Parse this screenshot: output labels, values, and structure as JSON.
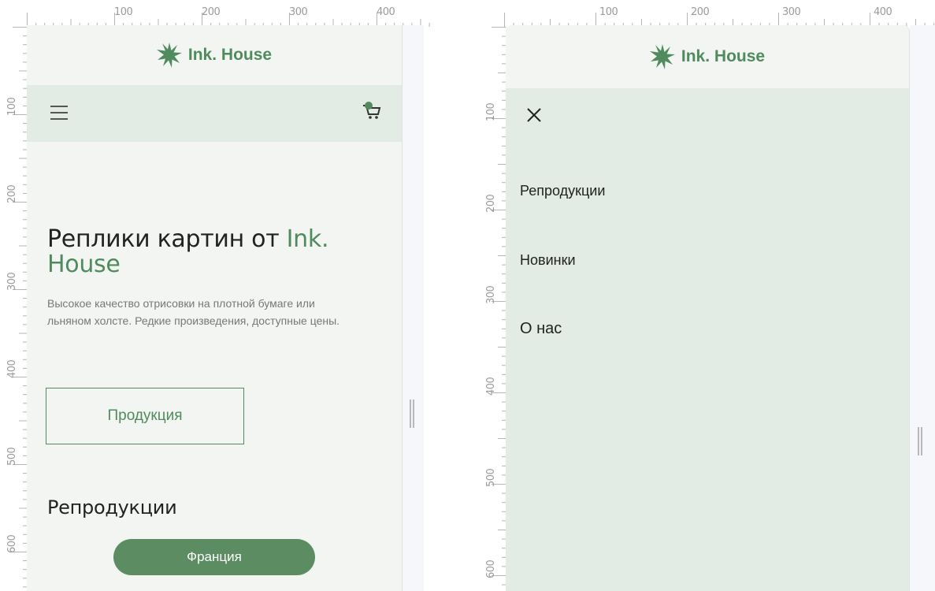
{
  "brand": {
    "name": "Ink. House",
    "color": "#4f8b5d"
  },
  "rulers": {
    "top": [
      "100",
      "200",
      "300",
      "400"
    ],
    "left": [
      "100",
      "200",
      "300",
      "400",
      "500",
      "600"
    ]
  },
  "left_screen": {
    "hero": {
      "title_main": "Реплики картин от ",
      "title_accent": "Ink. House",
      "subtitle": "Высокое качество отрисовки на плотной бумаге или льняном холсте. Редкие произведения, доступные цены."
    },
    "cta_button": "Продукция",
    "section_title": "Репродукции",
    "category_pill": "Франция",
    "cart_badge_icon": "cart-icon"
  },
  "right_screen": {
    "menu_items": [
      "Репродукции",
      "Новинки",
      "О нас"
    ],
    "close_icon": "close-icon"
  },
  "colors": {
    "page_bg": "#f3f5f3",
    "nav_bg": "#e2ebe4",
    "accent": "#4f8b5d",
    "pill_bg": "#5b8c62"
  }
}
